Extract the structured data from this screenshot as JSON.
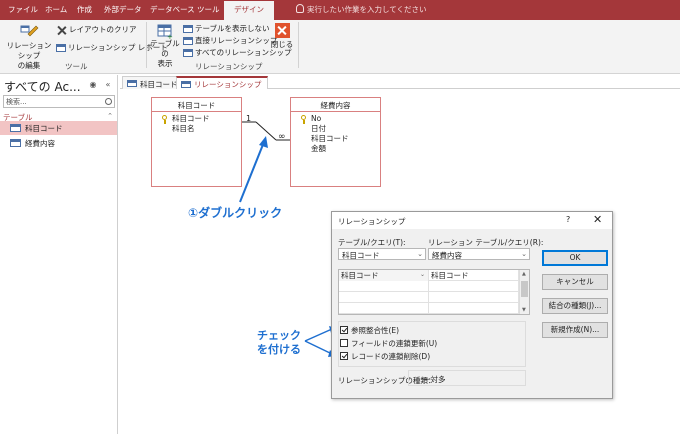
{
  "ribbon_tabs": [
    "ファイル",
    "ホーム",
    "作成",
    "外部データ",
    "データベース ツール",
    "デザイン"
  ],
  "active_tab": "デザイン",
  "tell_me": "実行したい作業を入力してください",
  "ribbon": {
    "edit_relationships": [
      "リレーションシップ",
      "の編集"
    ],
    "clear_layout": "レイアウトのクリア",
    "relationship_report": "リレーションシップ レポート",
    "tools_group": "ツール",
    "show_table": [
      "テーブルの",
      "表示"
    ],
    "hide_table": "テーブルを表示しない",
    "direct_relationships": "直接リレーションシップ",
    "all_relationships": "すべてのリレーションシップ",
    "close": "閉じる",
    "relationships_group": "リレーションシップ"
  },
  "nav": {
    "title": "すべての Ac...",
    "search_placeholder": "検索...",
    "category": "テーブル",
    "items": [
      "科目コード",
      "経費内容"
    ]
  },
  "doc_tabs": [
    "科目コード",
    "リレーションシップ"
  ],
  "tables": {
    "left": {
      "title": "科目コード",
      "fields": [
        "科目コード",
        "科目名"
      ]
    },
    "right": {
      "title": "経費内容",
      "fields": [
        "No",
        "日付",
        "科目コード",
        "金額"
      ]
    }
  },
  "annotations": {
    "double_click": "①ダブルクリック",
    "check": [
      "チェック",
      "を付ける"
    ]
  },
  "dialog": {
    "title": "リレーションシップ",
    "help": "?",
    "close": "✕",
    "table_query_label": "テーブル/クエリ(T):",
    "related_table_label": "リレーション テーブル/クエリ(R):",
    "table_value": "科目コード",
    "related_value": "経費内容",
    "grid_left": "科目コード",
    "grid_right": "科目コード",
    "ok": "OK",
    "cancel": "キャンセル",
    "join_type": "結合の種類(J)...",
    "create_new": "新規作成(N)...",
    "enforce_integrity": "参照整合性(E)",
    "cascade_update": "フィールドの連鎖更新(U)",
    "cascade_delete": "レコードの連鎖削除(D)",
    "relationship_type_label": "リレーションシップの種類：",
    "relationship_type_value": "一対多"
  },
  "checkbox_states": {
    "enforce_integrity": true,
    "cascade_update": false,
    "cascade_delete": true
  },
  "colors": {
    "ribbon": "#a4373a",
    "annotation": "#1e6fd0",
    "selection": "#f2c4c4"
  }
}
